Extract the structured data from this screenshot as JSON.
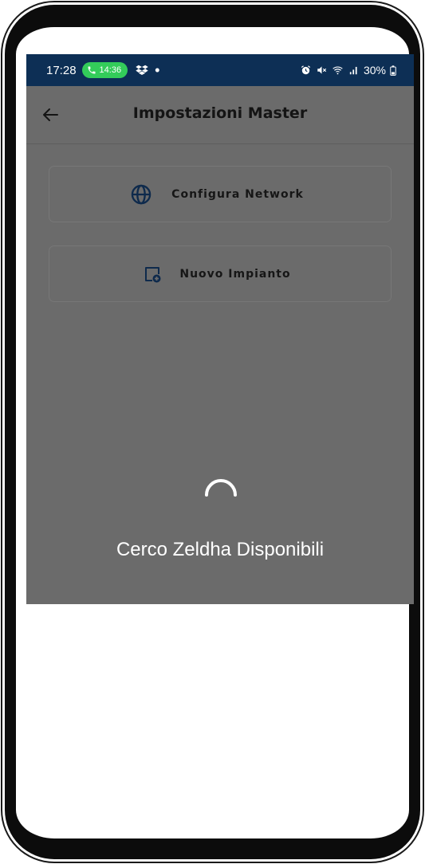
{
  "status_bar": {
    "time": "17:28",
    "call_timer": "14:36",
    "battery": "30%"
  },
  "app_bar": {
    "title": "Impostazioni Master"
  },
  "menu": {
    "network_label": "Configura Network",
    "impianto_label": "Nuovo Impianto"
  },
  "loading": {
    "text": "Cerco Zeldha Disponibili"
  },
  "colors": {
    "status_bar_bg": "#0d2f55",
    "call_pill": "#33cc5a",
    "overlay": "#6b6b6b",
    "loading_text": "#ffffff"
  },
  "icons": {
    "back": "arrow-left-icon",
    "network": "globe-icon",
    "impianto": "add-document-icon",
    "call": "phone-icon",
    "dropbox": "dropbox-icon",
    "alarm": "alarm-icon",
    "mute": "mute-icon",
    "wifi": "wifi-icon",
    "signal": "signal-icon",
    "battery": "battery-icon"
  }
}
